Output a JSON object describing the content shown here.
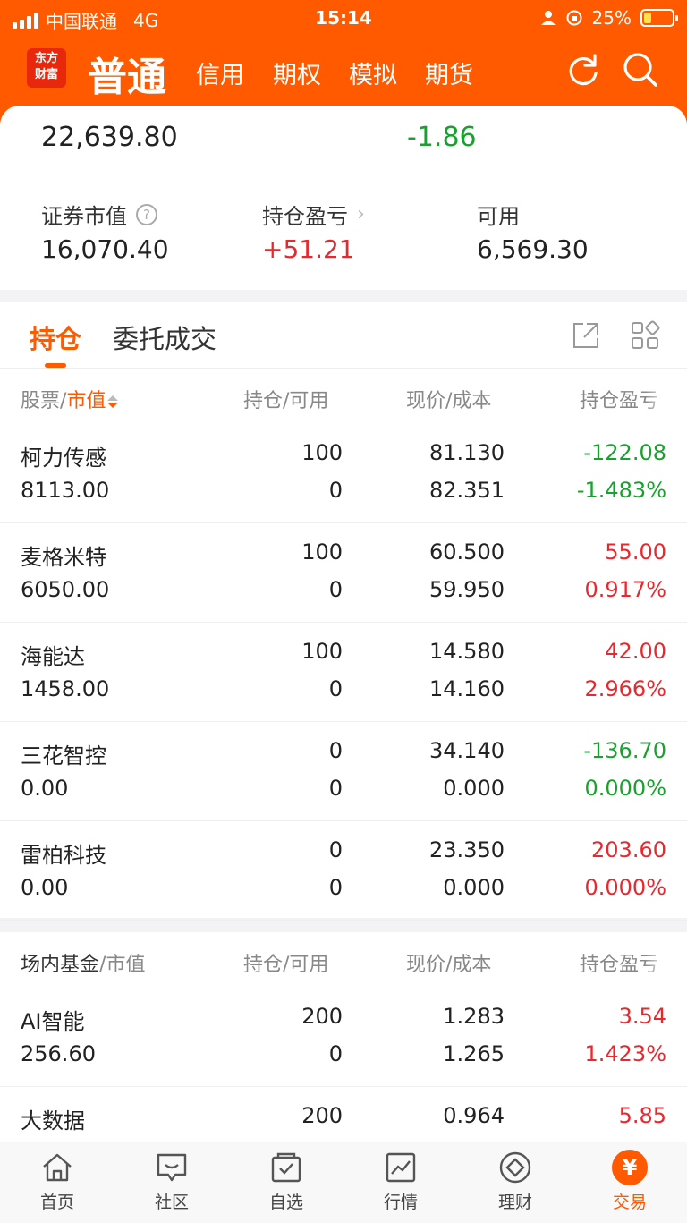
{
  "status_bar": {
    "carrier": "中国联通",
    "network": "4G",
    "time": "15:14",
    "battery": "25%",
    "battery_level": 0.25
  },
  "header": {
    "logo_line1": "东方",
    "logo_line2": "财富",
    "tabs": [
      "普通",
      "信用",
      "期权",
      "模拟",
      "期货"
    ],
    "active_tab": "普通"
  },
  "summary": {
    "total_assets": "22,639.80",
    "daily_pnl": "-1.86",
    "market_value_label": "证券市值",
    "market_value": "16,070.40",
    "position_pnl_label": "持仓盈亏",
    "position_pnl": "+51.21",
    "available_label": "可用",
    "available": "6,569.30"
  },
  "position_tabs": [
    "持仓",
    "委托成交"
  ],
  "stock_table": {
    "header_stock": "股票",
    "header_value": "市值",
    "header_hold": "持仓/可用",
    "header_price": "现价/成本",
    "header_pnl": "持仓盈亏",
    "rows": [
      {
        "name": "柯力传感",
        "value": "8113.00",
        "hold": "100",
        "avail": "0",
        "price": "81.130",
        "cost": "82.351",
        "pnl": "-122.08",
        "pnl_pct": "-1.483%",
        "dir": "down"
      },
      {
        "name": "麦格米特",
        "value": "6050.00",
        "hold": "100",
        "avail": "0",
        "price": "60.500",
        "cost": "59.950",
        "pnl": "55.00",
        "pnl_pct": "0.917%",
        "dir": "up"
      },
      {
        "name": "海能达",
        "value": "1458.00",
        "hold": "100",
        "avail": "0",
        "price": "14.580",
        "cost": "14.160",
        "pnl": "42.00",
        "pnl_pct": "2.966%",
        "dir": "up"
      },
      {
        "name": "三花智控",
        "value": "0.00",
        "hold": "0",
        "avail": "0",
        "price": "34.140",
        "cost": "0.000",
        "pnl": "-136.70",
        "pnl_pct": "0.000%",
        "dir": "down"
      },
      {
        "name": "雷柏科技",
        "value": "0.00",
        "hold": "0",
        "avail": "0",
        "price": "23.350",
        "cost": "0.000",
        "pnl": "203.60",
        "pnl_pct": "0.000%",
        "dir": "up"
      }
    ]
  },
  "fund_table": {
    "header_fund": "场内基金",
    "header_value": "市值",
    "header_hold": "持仓/可用",
    "header_price": "现价/成本",
    "header_pnl": "持仓盈亏",
    "rows": [
      {
        "name": "AI智能",
        "value": "256.60",
        "hold": "200",
        "avail": "0",
        "price": "1.283",
        "cost": "1.265",
        "pnl": "3.54",
        "pnl_pct": "1.423%",
        "dir": "up"
      },
      {
        "name": "大数据",
        "value": "",
        "hold": "200",
        "avail": "",
        "price": "0.964",
        "cost": "",
        "pnl": "5.85",
        "pnl_pct": "",
        "dir": "up"
      }
    ]
  },
  "bottom_nav": [
    "首页",
    "社区",
    "自选",
    "行情",
    "理财",
    "交易"
  ],
  "colors": {
    "brand": "#ff5a00",
    "up": "#e8282f",
    "down": "#18a12e"
  }
}
